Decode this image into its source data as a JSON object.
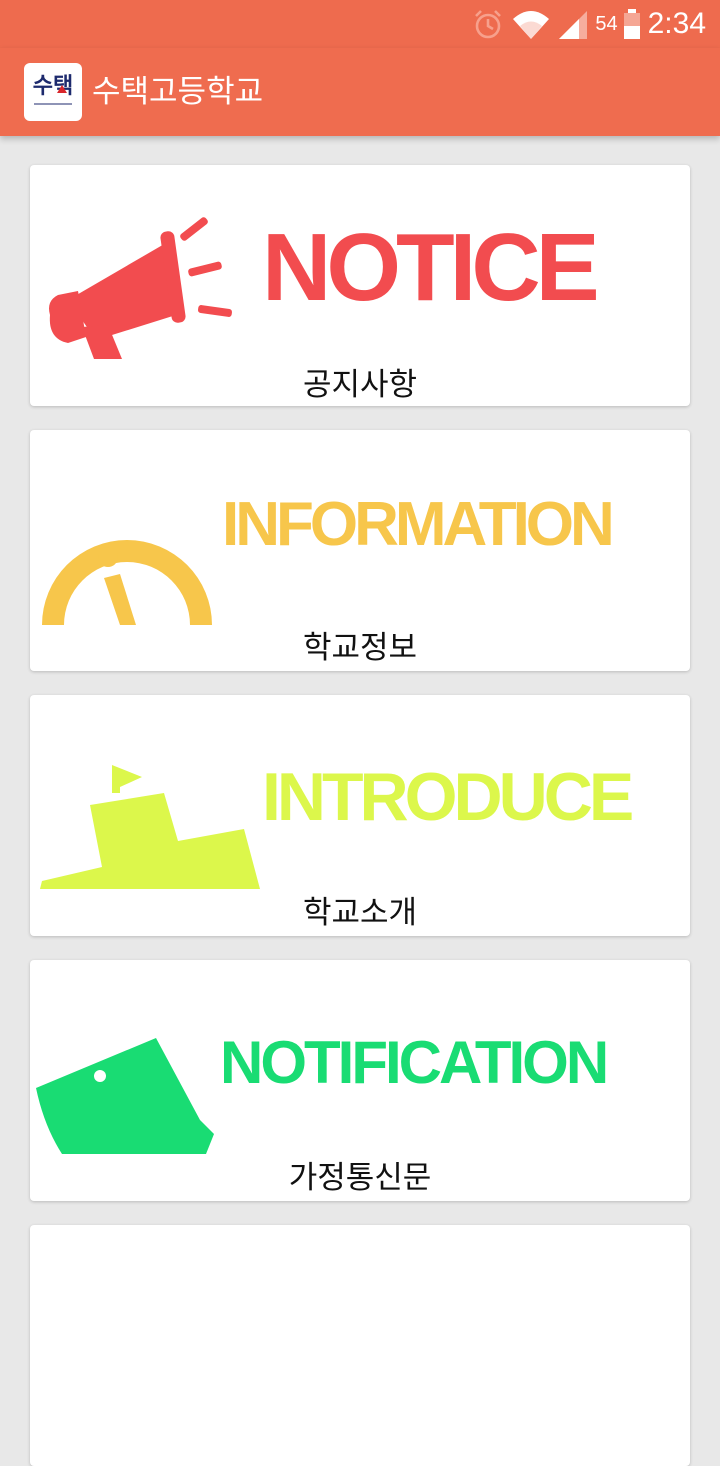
{
  "status_bar": {
    "time": "2:34",
    "battery_percent": "54",
    "icons": [
      "alarm-icon",
      "wifi-icon",
      "signal-icon",
      "battery-icon"
    ]
  },
  "app_bar": {
    "logo_text": "수택",
    "title": "수택고등학교"
  },
  "menu": [
    {
      "english": "NOTICE",
      "korean": "공지사항",
      "color": "#f24c4f",
      "icon": "megaphone-icon"
    },
    {
      "english": "INFORMATION",
      "korean": "학교정보",
      "color": "#f7c64b",
      "icon": "info-icon"
    },
    {
      "english": "INTRODUCE",
      "korean": "학교소개",
      "color": "#dcf74b",
      "icon": "ship-icon"
    },
    {
      "english": "NOTIFICATION",
      "korean": "가정통신문",
      "color": "#19dc73",
      "icon": "letter-icon"
    }
  ],
  "colors": {
    "app_bar": "#ef6c4f",
    "background": "#e8e8e8"
  }
}
